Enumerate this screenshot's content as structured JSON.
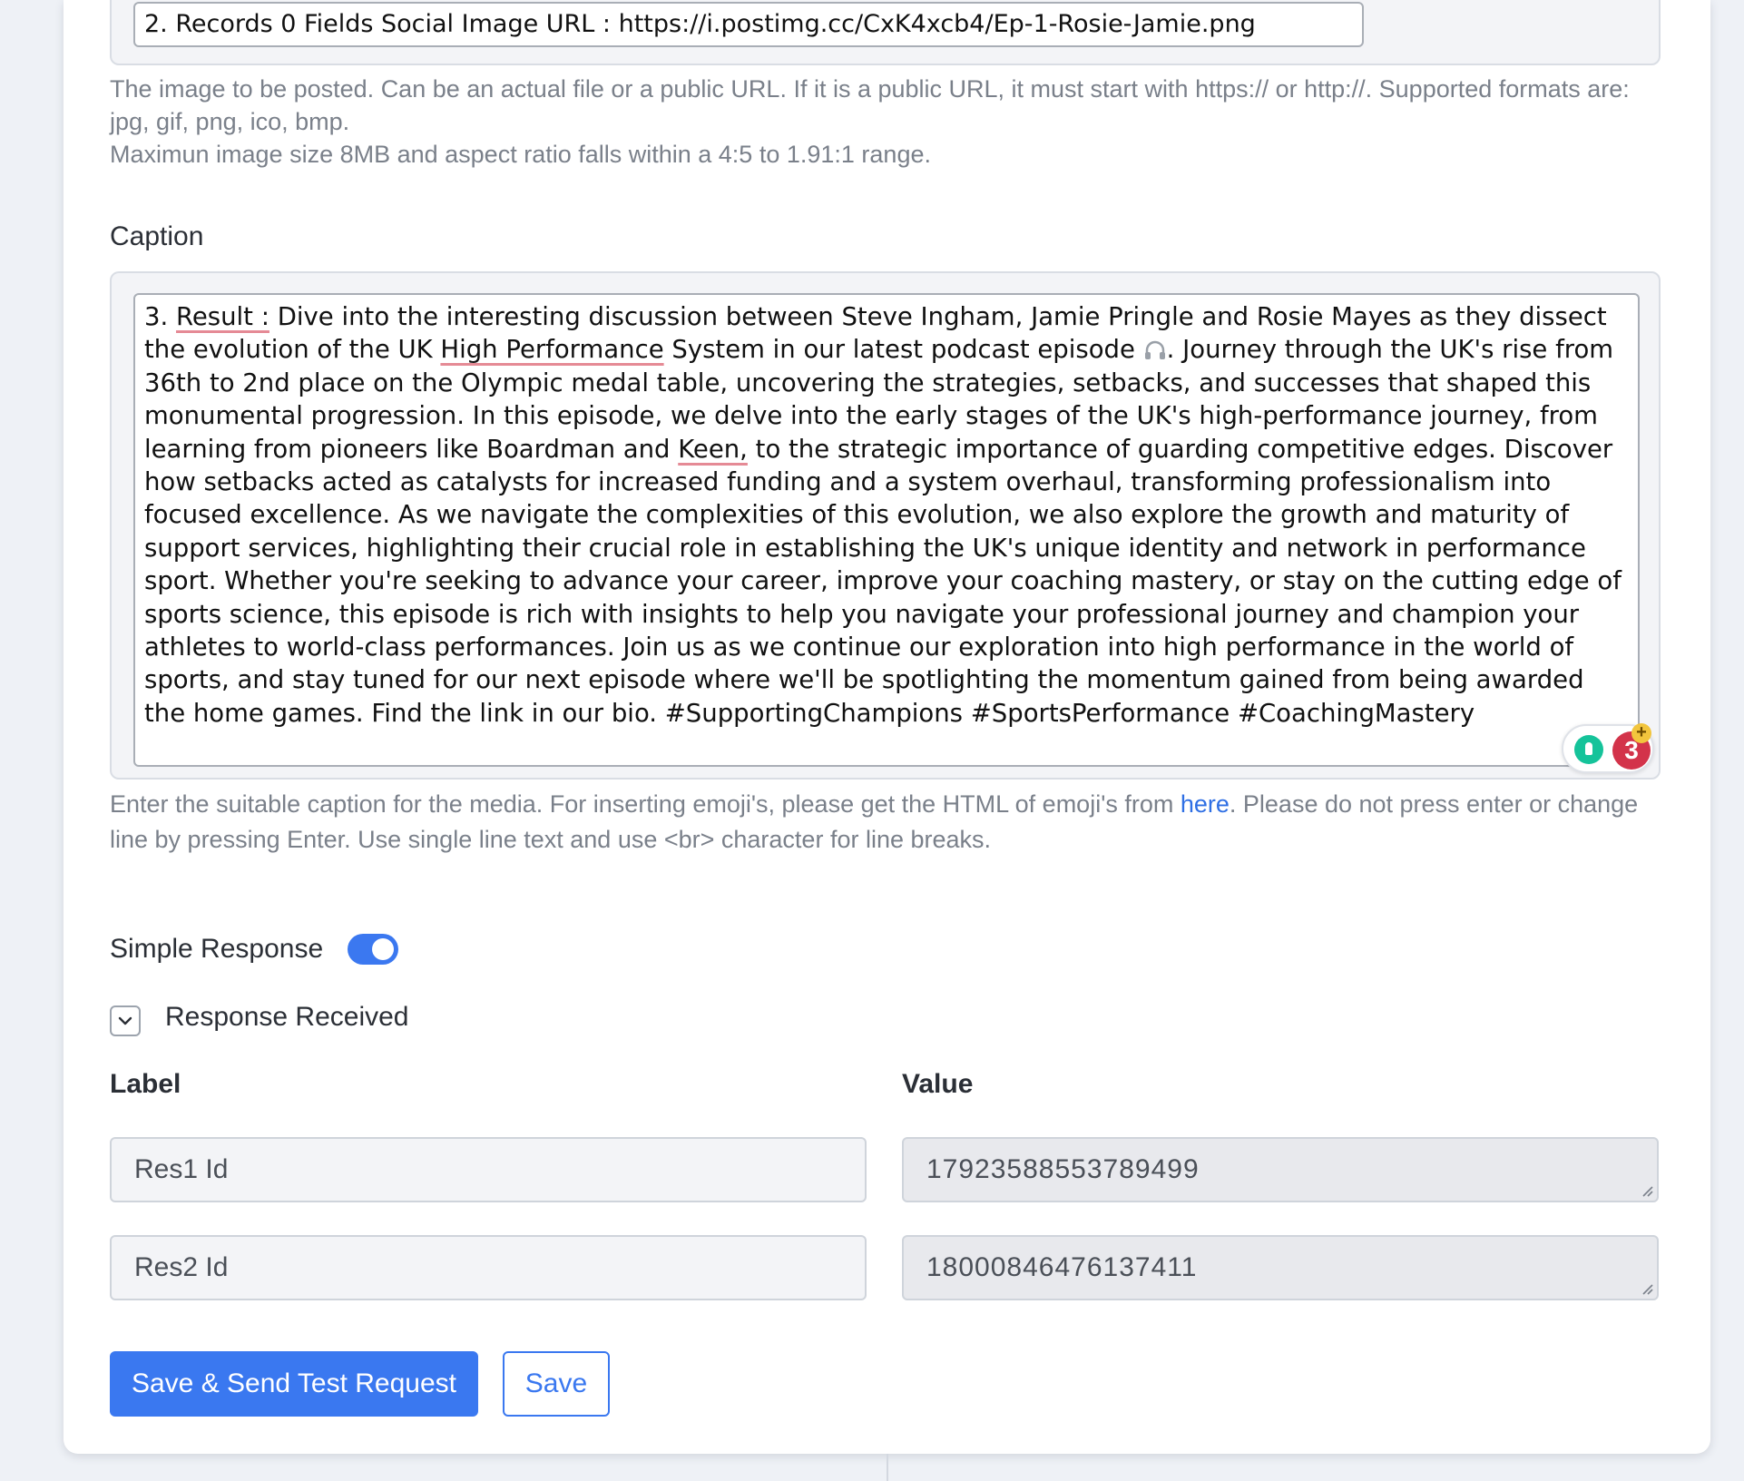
{
  "image_field": {
    "value": "2. Records 0 Fields Social Image URL : https://i.postimg.cc/CxK4xcb4/Ep-1-Rosie-Jamie.png",
    "help_line1": "The image to be posted. Can be an actual file or a public URL. If it is a public URL, it must start with https:// or http://. Supported formats are: jpg, gif, png, ico, bmp.",
    "help_line2": "Maximun image size 8MB and aspect ratio falls within a 4:5 to 1.91:1 range."
  },
  "caption": {
    "label": "Caption",
    "prefix": "3. ",
    "result_token": "Result :",
    "part1": " Dive into the interesting discussion between Steve Ingham, Jamie Pringle and Rosie Mayes as they dissect the evolution of the UK ",
    "spell1": "High Performance",
    "part2": " System in our latest podcast episode ",
    "part3": ". Journey through the UK's rise from 36th to 2nd place on the Olympic medal table, uncovering the strategies, setbacks, and successes that shaped this monumental progression. In this episode, we delve into the early stages of the UK's high-performance journey, from learning from pioneers like Boardman and ",
    "spell2": "Keen,",
    "part4": " to the strategic importance of guarding competitive edges. Discover how setbacks acted as catalysts for increased funding and a system overhaul, transforming professionalism into focused excellence. As we navigate the complexities of this evolution, we also explore the growth and maturity of support services, highlighting their crucial role in establishing the UK's unique identity and network in performance sport. Whether you're seeking to advance your career, improve your coaching mastery, or stay on the cutting edge of sports science, this episode is rich with insights to help you navigate your professional journey and champion your athletes to world-class performances. Join us as we continue our exploration into high performance in the world of sports, and stay tuned for our next episode where we'll be spotlighting the momentum gained from being awarded the home games. Find the link in our bio. #SupportingChampions #SportsPerformance #CoachingMastery",
    "grammarly_count": "3",
    "help_before": "Enter the suitable caption for the media. For inserting emoji's, please get the HTML of emoji's from ",
    "help_link": "here",
    "help_after": ". Please do not press enter or change line by pressing Enter. Use single line text and use <br> character for line breaks."
  },
  "simple_response": {
    "label": "Simple Response",
    "enabled": true
  },
  "response_received": {
    "label": "Response Received",
    "col_label": "Label",
    "col_value": "Value",
    "rows": [
      {
        "label": "Res1 Id",
        "value": "17923588553789499"
      },
      {
        "label": "Res2 Id",
        "value": "18000846476137411"
      }
    ]
  },
  "actions": {
    "primary": "Save & Send Test Request",
    "secondary": "Save"
  },
  "colors": {
    "accent": "#3a78f0",
    "link": "#2f6fe4",
    "spell_underline": "#e58a95",
    "grammarly_green": "#15c39a",
    "grammarly_red": "#d3334a"
  }
}
